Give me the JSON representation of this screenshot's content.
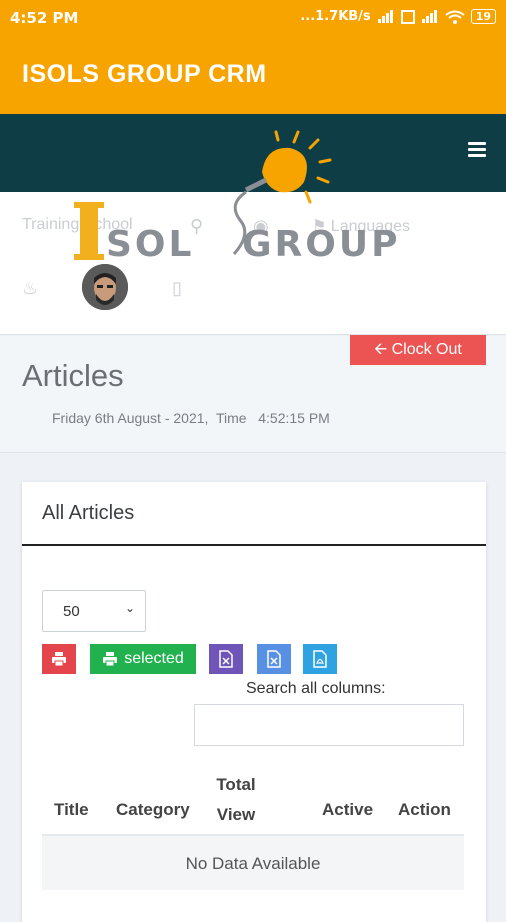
{
  "status_bar": {
    "time": "4:52 PM",
    "network_speed": "...1.7KB/s",
    "battery": "19",
    "icons": [
      "signal-icon",
      "signal-icon-2",
      "wifi-icon",
      "battery-icon"
    ]
  },
  "app_bar": {
    "title": "ISOLS GROUP CRM"
  },
  "nav": {
    "school": "Training School",
    "languages": "Languages"
  },
  "logo": {
    "text_left": "SOL",
    "text_right": "GROUP"
  },
  "page": {
    "title": "Articles",
    "date": "Friday 6th August - 2021,",
    "time_label": "Time",
    "time_value": "4:52:15 PM",
    "clock_out_label": "Clock Out"
  },
  "card": {
    "title": "All Articles",
    "page_size": "50",
    "print_selected_label": "selected",
    "search_label": "Search all columns:",
    "search_placeholder": "",
    "columns": [
      "Title",
      "Category",
      "Total View",
      "Active",
      "Action"
    ],
    "empty_message": "No Data Available"
  },
  "colors": {
    "accent": "#f7a300",
    "dark_band": "#0f3d45",
    "clock_out": "#ec5353",
    "print": "#e4444b",
    "print_selected": "#21b24f",
    "excel": "#6f55b8",
    "csv": "#5891e3",
    "pdf": "#2fa3e2"
  }
}
